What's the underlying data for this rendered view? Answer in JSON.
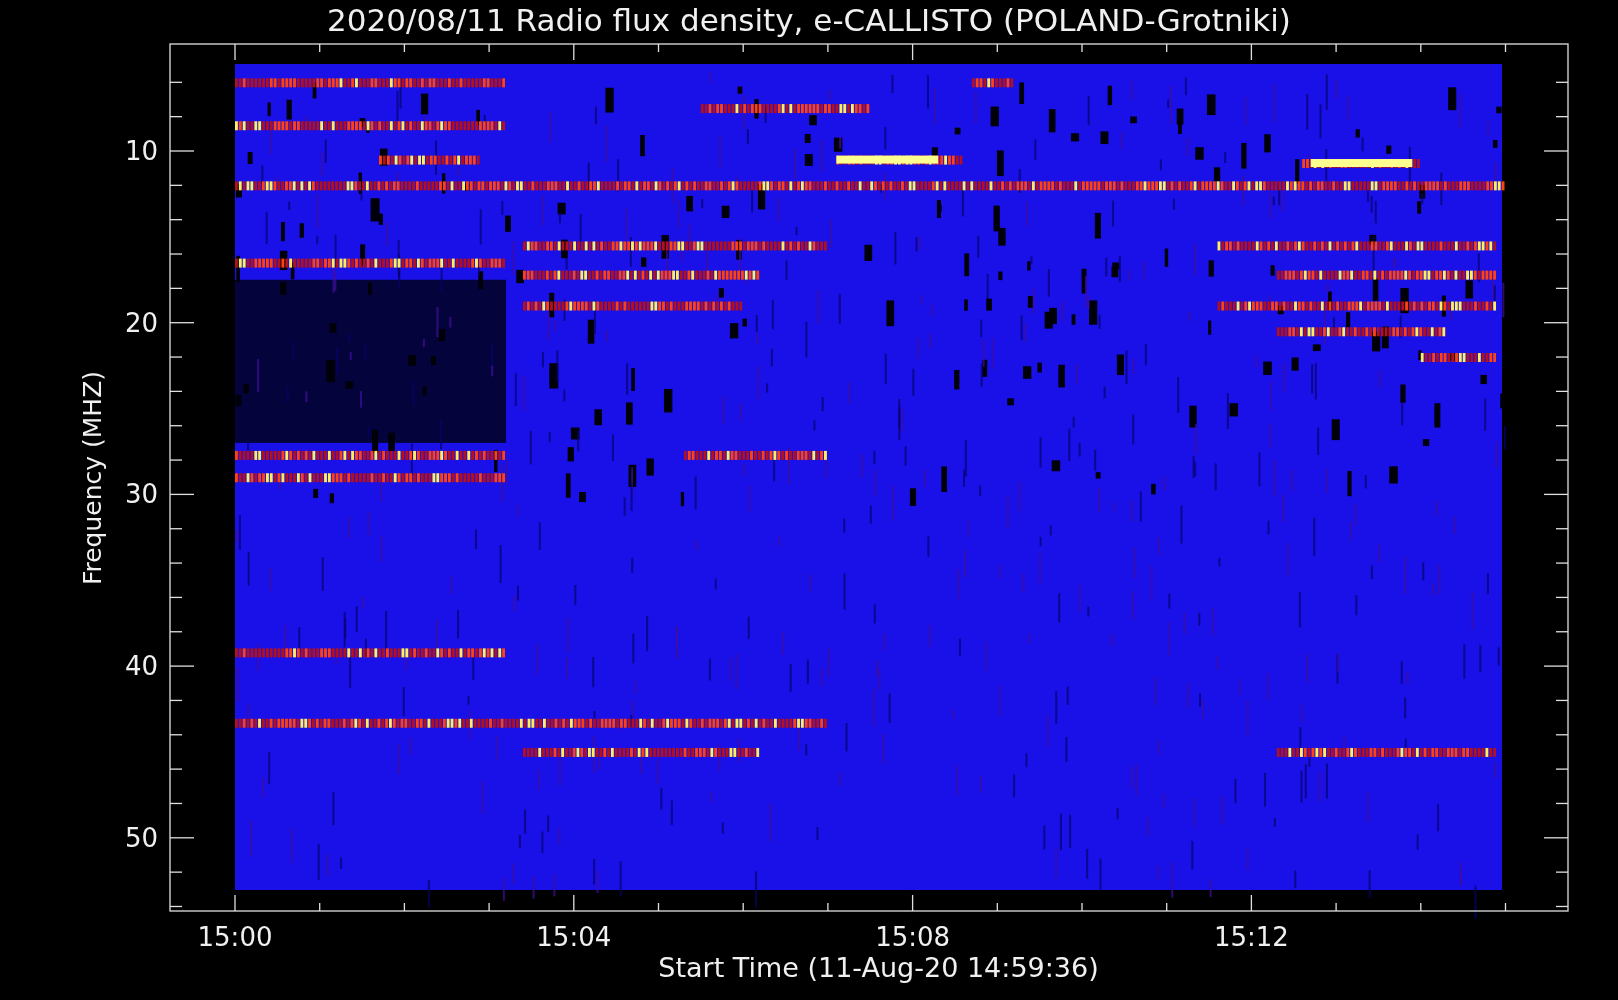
{
  "plot": {
    "title": "2020/08/11  Radio flux density, e-CALLISTO (POLAND-Grotniki)",
    "xlabel": "Start Time (11-Aug-20 14:59:36)",
    "ylabel": "Frequency (MHZ)",
    "xticks": [
      "15:00",
      "15:04",
      "15:08",
      "15:12"
    ],
    "yticks": [
      "10",
      "20",
      "30",
      "40",
      "50"
    ]
  }
}
